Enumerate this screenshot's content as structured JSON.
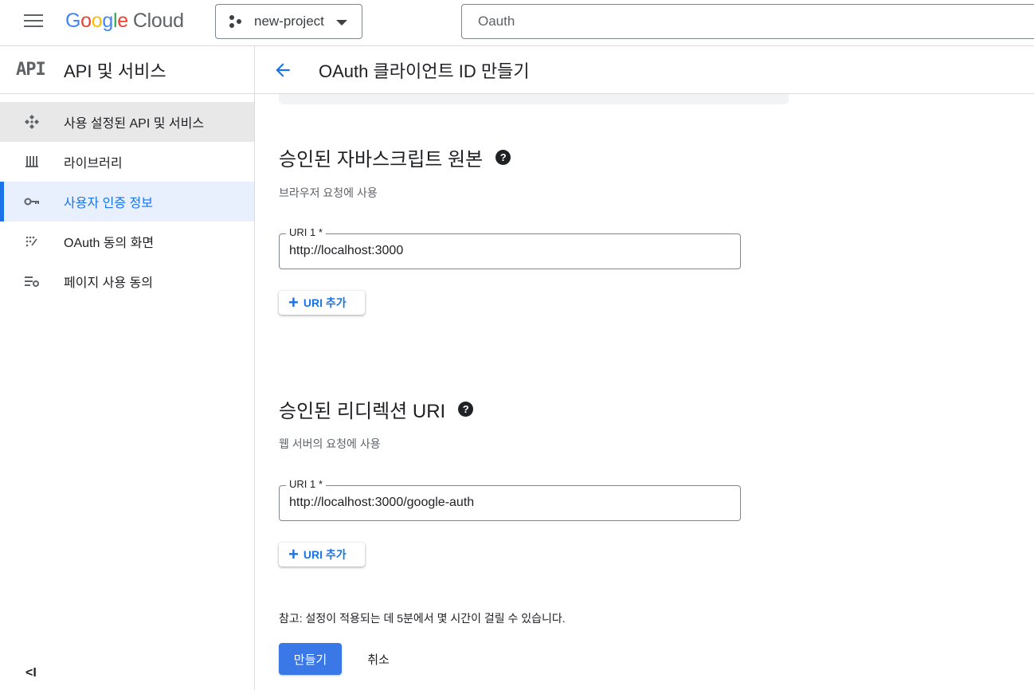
{
  "topbar": {
    "logo_google": [
      "G",
      "o",
      "o",
      "g",
      "l",
      "e"
    ],
    "logo_cloud": "Cloud",
    "project_name": "new-project",
    "search_value": "Oauth"
  },
  "sidebar": {
    "api_logo": "API",
    "title": "API 및 서비스",
    "items": [
      {
        "label": "사용 설정된 API 및 서비스",
        "icon": "diamond-dots-icon",
        "state": "enabled"
      },
      {
        "label": "라이브러리",
        "icon": "library-icon",
        "state": "normal"
      },
      {
        "label": "사용자 인증 정보",
        "icon": "key-icon",
        "state": "selected"
      },
      {
        "label": "OAuth 동의 화면",
        "icon": "consent-dots-icon",
        "state": "normal"
      },
      {
        "label": "페이지 사용 동의",
        "icon": "settings-list-icon",
        "state": "normal"
      }
    ],
    "collapse_label": "<I"
  },
  "header": {
    "title": "OAuth 클라이언트 ID 만들기"
  },
  "js_origins": {
    "title": "승인된 자바스크립트 원본",
    "subtitle": "브라우저 요청에 사용",
    "field_label": "URI 1 *",
    "field_value": "http://localhost:3000",
    "add_label": "URI 추가"
  },
  "redirect_uris": {
    "title": "승인된 리디렉션 URI",
    "subtitle": "웹 서버의 요청에 사용",
    "field_label": "URI 1 *",
    "field_value": "http://localhost:3000/google-auth",
    "add_label": "URI 추가"
  },
  "note": "참고: 설정이 적용되는 데 5분에서 몇 시간이 걸릴 수 있습니다.",
  "actions": {
    "create_label": "만들기",
    "cancel_label": "취소"
  },
  "colors": {
    "accent": "#1a73e8",
    "primary_button": "#3b78e7",
    "selected_bg": "#e8f0fe"
  }
}
